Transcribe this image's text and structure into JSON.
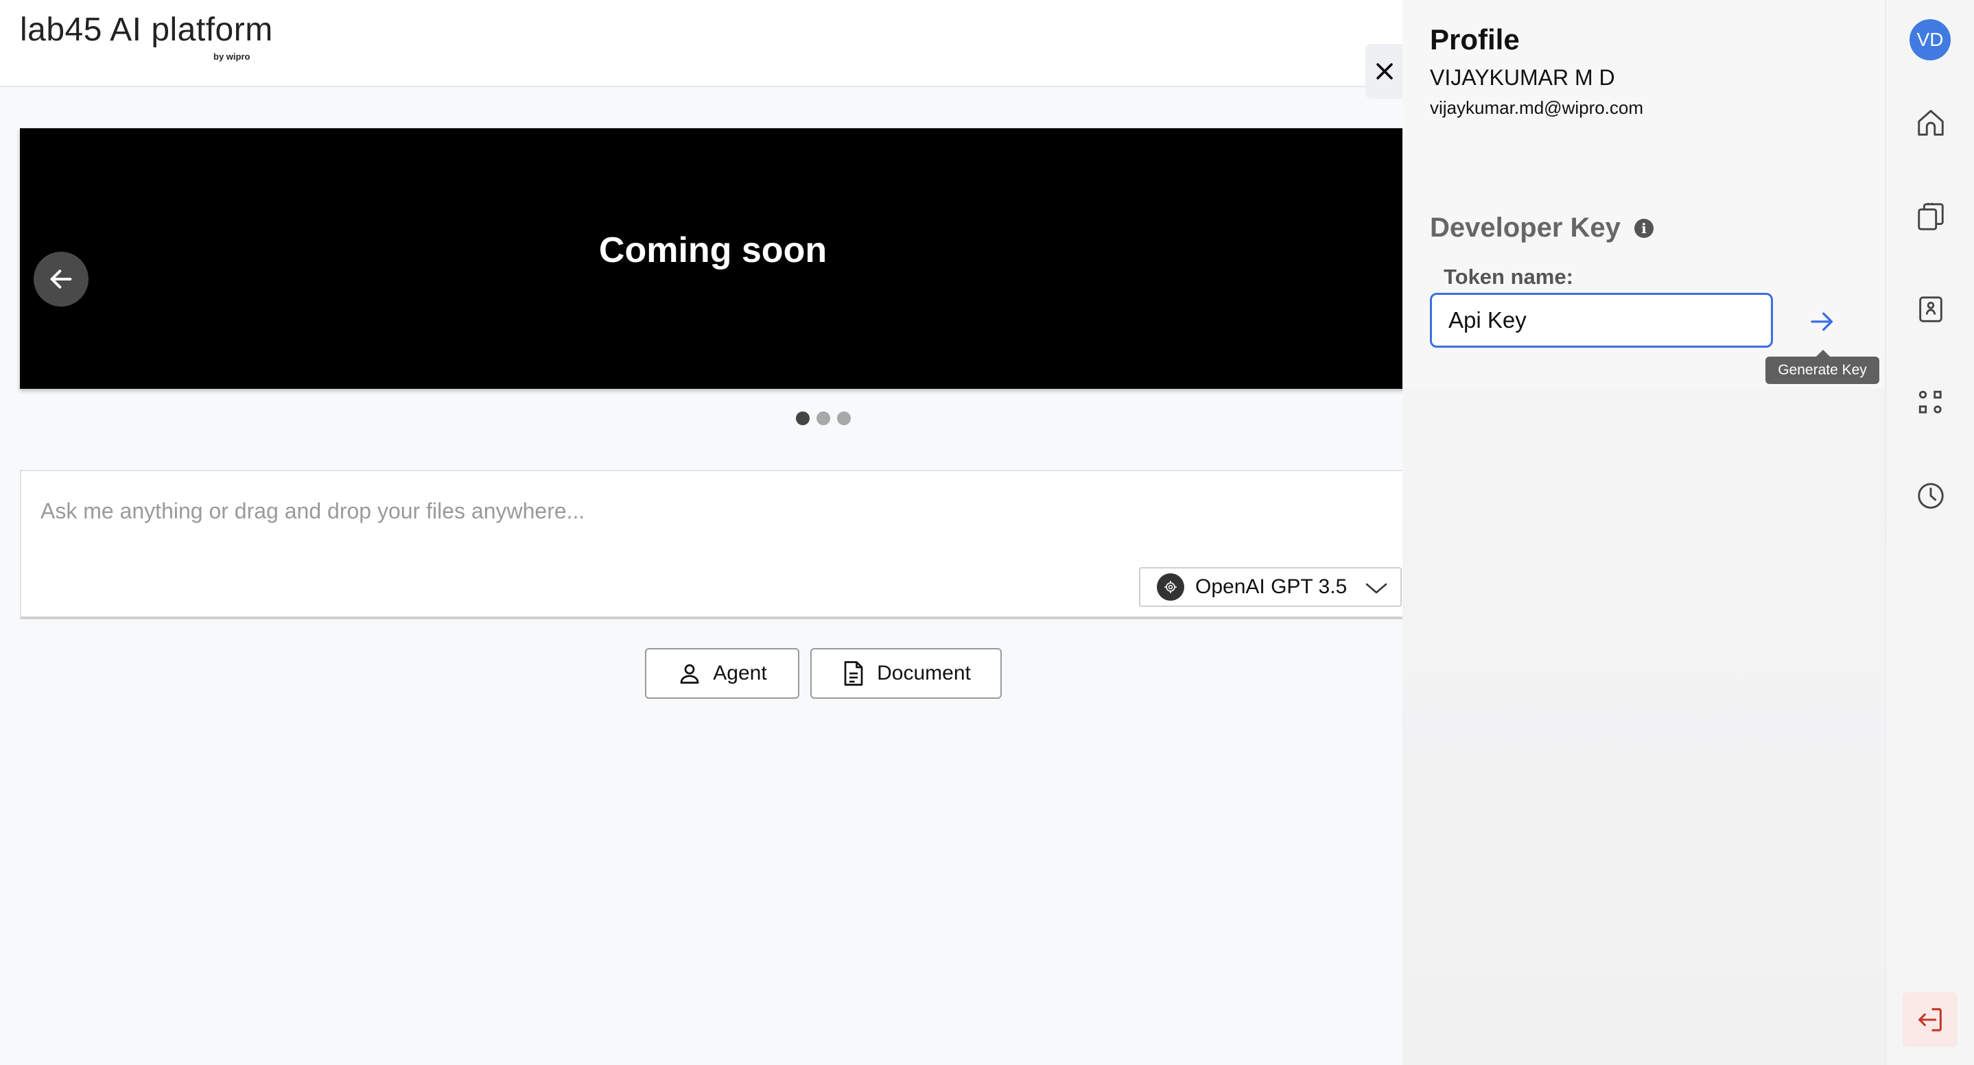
{
  "app": {
    "title": "lab45 AI platform",
    "subtitle": "by wipro"
  },
  "carousel": {
    "title": "Coming soon",
    "prev_icon": "arrow-left-icon",
    "slides_total": 3,
    "active_slide": 1
  },
  "prompt": {
    "placeholder": "Ask me anything or drag and drop your files anywhere...",
    "value": "",
    "model": {
      "label": "OpenAI GPT 3.5",
      "icon": "openai-icon"
    }
  },
  "actions": {
    "agent_label": "Agent",
    "document_label": "Document"
  },
  "profile": {
    "heading": "Profile",
    "name": "VIJAYKUMAR M D",
    "email": "vijaykumar.md@wipro.com",
    "developer_key": {
      "heading": "Developer Key",
      "info_glyph": "i",
      "token_label": "Token name:",
      "token_value": "Api Key",
      "generate_tooltip": "Generate Key"
    }
  },
  "rail": {
    "avatar_initials": "VD",
    "icons": [
      "home-icon",
      "documents-icon",
      "agent-card-icon",
      "apps-icon",
      "history-icon"
    ],
    "logout_icon": "logout-icon"
  },
  "colors": {
    "accent": "#3a6fe0",
    "avatar_bg": "#3f7be0",
    "logout": "#c0392b",
    "carousel_bg": "#000000"
  }
}
